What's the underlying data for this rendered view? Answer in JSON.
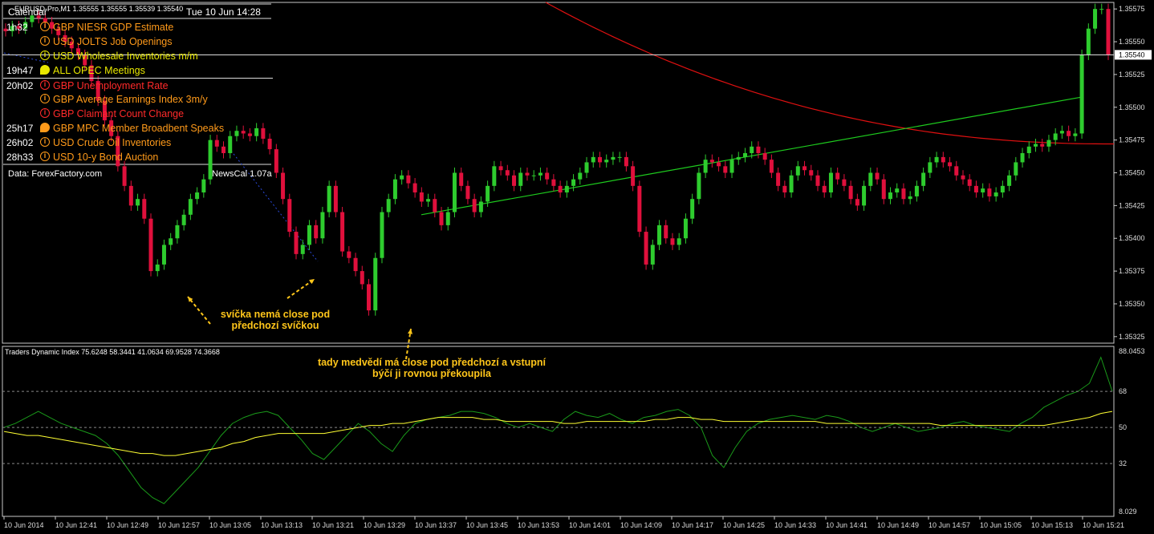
{
  "window": {
    "symbol_label": "EURUSD-Pro,M1  1.35555 1.35555 1.35539 1.35540",
    "indicator_label": "Traders Dynamic Index 75.6248 58.3441 41.0634 69.9528 74.3668"
  },
  "calendar": {
    "title": "Calendar",
    "datetime": "Tue 10 Jun 14:28",
    "events": [
      {
        "time": "1h32",
        "icon": "info-icon",
        "currency": "GBP",
        "name": "NIESR GDP Estimate",
        "color": "#ff9a1a"
      },
      {
        "time": "",
        "icon": "info-icon",
        "currency": "USD",
        "name": "JOLTS Job Openings",
        "color": "#ff9a1a"
      },
      {
        "time": "",
        "icon": "info-icon",
        "currency": "USD",
        "name": "Wholesale Inventories m/m",
        "color": "#e8e800"
      },
      {
        "time": "19h47",
        "icon": "speech-icon",
        "currency": "ALL",
        "name": "OPEC Meetings",
        "color": "#e8e800"
      },
      {
        "time": "20h02",
        "icon": "info-icon",
        "currency": "GBP",
        "name": "Unemployment Rate",
        "color": "#ff2a2a"
      },
      {
        "time": "",
        "icon": "info-icon",
        "currency": "GBP",
        "name": "Average Earnings Index 3m/y",
        "color": "#ff9a1a"
      },
      {
        "time": "",
        "icon": "info-icon",
        "currency": "GBP",
        "name": "Claimant Count Change",
        "color": "#ff2a2a"
      },
      {
        "time": "25h17",
        "icon": "speech-icon",
        "currency": "GBP",
        "name": "MPC Member Broadbent Speaks",
        "color": "#ff9a1a"
      },
      {
        "time": "26h02",
        "icon": "info-icon",
        "currency": "USD",
        "name": "Crude Oil Inventories",
        "color": "#ff9a1a"
      },
      {
        "time": "28h33",
        "icon": "info-icon",
        "currency": "USD",
        "name": "10-y Bond Auction",
        "color": "#ff9a1a"
      }
    ],
    "footer": "Data: ForexFactory.com",
    "version": "NewsCal 1.07a"
  },
  "annotations": [
    {
      "line1": "svíčka nemá close pod",
      "line2": "předchozí svíčkou"
    },
    {
      "line1": "tady medvědí má close pod předchozí a vstupní",
      "line2": "býčí ji rovnou překoupila"
    }
  ],
  "colors": {
    "bull": "#2ecc2e",
    "bear": "#e0103c",
    "ma": "#e01010",
    "trendline": "#1ecc1e",
    "tdi_green": "#1a9a1a",
    "tdi_yellow": "#ffff33",
    "annotation": "#ffc61a"
  },
  "chart_data": {
    "type": "candlestick",
    "price_axis": {
      "ticks": [
        "1.35575",
        "1.35550",
        "1.35525",
        "1.35500",
        "1.35475",
        "1.35450",
        "1.35425",
        "1.35400",
        "1.35375",
        "1.35350",
        "1.35325"
      ],
      "current_price": "1.35540",
      "ylim": [
        1.3532,
        1.3558
      ]
    },
    "indicator_axis": {
      "ticks": [
        "88.0453",
        "68",
        "50",
        "32",
        "8.029"
      ],
      "levels": [
        68,
        50,
        32
      ],
      "ylim": [
        8.029,
        88.0453
      ]
    },
    "x_labels": [
      "10 Jun 2014",
      "10 Jun 12:41",
      "10 Jun 12:49",
      "10 Jun 12:57",
      "10 Jun 13:05",
      "10 Jun 13:13",
      "10 Jun 13:21",
      "10 Jun 13:29",
      "10 Jun 13:37",
      "10 Jun 13:45",
      "10 Jun 13:53",
      "10 Jun 14:01",
      "10 Jun 14:09",
      "10 Jun 14:17",
      "10 Jun 14:25",
      "10 Jun 14:33",
      "10 Jun 14:41",
      "10 Jun 14:49",
      "10 Jun 14:57",
      "10 Jun 15:05",
      "10 Jun 15:13",
      "10 Jun 15:21"
    ],
    "closes": [
      1.35558,
      1.35562,
      1.3556,
      1.35565,
      1.3557,
      1.35568,
      1.35565,
      1.3556,
      1.35555,
      1.3555,
      1.35545,
      1.3554,
      1.35532,
      1.3552,
      1.35505,
      1.3549,
      1.35478,
      1.35455,
      1.3544,
      1.35425,
      1.3543,
      1.35415,
      1.35375,
      1.3538,
      1.35395,
      1.354,
      1.3541,
      1.35418,
      1.3543,
      1.35435,
      1.35445,
      1.35475,
      1.3547,
      1.35465,
      1.35478,
      1.35482,
      1.3548,
      1.35478,
      1.35484,
      1.35476,
      1.35468,
      1.3545,
      1.3543,
      1.35405,
      1.35388,
      1.35395,
      1.3541,
      1.354,
      1.3542,
      1.3544,
      1.3542,
      1.3539,
      1.35385,
      1.35375,
      1.35365,
      1.35345,
      1.35385,
      1.3542,
      1.3543,
      1.35445,
      1.35448,
      1.35442,
      1.35435,
      1.35428,
      1.3543,
      1.3542,
      1.3541,
      1.3542,
      1.3545,
      1.3544,
      1.3543,
      1.3542,
      1.35428,
      1.3544,
      1.35455,
      1.35452,
      1.35448,
      1.3544,
      1.3545,
      1.35448,
      1.35448,
      1.3545,
      1.35445,
      1.3544,
      1.35435,
      1.3544,
      1.35445,
      1.3545,
      1.35458,
      1.35462,
      1.35458,
      1.3546,
      1.35462,
      1.35462,
      1.35455,
      1.3544,
      1.35405,
      1.3538,
      1.35395,
      1.3541,
      1.354,
      1.35395,
      1.354,
      1.35415,
      1.3543,
      1.3545,
      1.3546,
      1.35458,
      1.35455,
      1.3545,
      1.3546,
      1.35462,
      1.35465,
      1.3547,
      1.35465,
      1.3546,
      1.3545,
      1.3544,
      1.35435,
      1.35448,
      1.35455,
      1.35452,
      1.35448,
      1.3544,
      1.35435,
      1.3545,
      1.35445,
      1.3544,
      1.3543,
      1.35425,
      1.3544,
      1.3545,
      1.35445,
      1.3543,
      1.35435,
      1.35438,
      1.3543,
      1.35432,
      1.3544,
      1.3545,
      1.35458,
      1.35462,
      1.35458,
      1.35455,
      1.35448,
      1.35445,
      1.3544,
      1.35435,
      1.35438,
      1.35432,
      1.35435,
      1.3544,
      1.35448,
      1.35458,
      1.35465,
      1.3547,
      1.35472,
      1.3547,
      1.35475,
      1.3548,
      1.35482,
      1.35478,
      1.3548,
      1.3554,
      1.3556,
      1.35575,
      1.35575,
      1.3554
    ],
    "moving_average": {
      "start": 1.3558,
      "end": 1.35472
    },
    "trendline": {
      "start": 1.35418,
      "end": 1.35508
    },
    "tdi_green": [
      50,
      52,
      55,
      58,
      55,
      52,
      50,
      48,
      46,
      42,
      36,
      28,
      20,
      15,
      12,
      18,
      24,
      30,
      38,
      46,
      52,
      55,
      57,
      58,
      56,
      50,
      44,
      37,
      34,
      40,
      46,
      52,
      48,
      42,
      38,
      46,
      52,
      54,
      55,
      56,
      58,
      58,
      57,
      55,
      52,
      50,
      52,
      50,
      48,
      54,
      58,
      56,
      55,
      57,
      54,
      52,
      55,
      56,
      58,
      59,
      56,
      50,
      36,
      30,
      40,
      48,
      52,
      54,
      55,
      56,
      55,
      54,
      56,
      55,
      53,
      50,
      48,
      50,
      52,
      50,
      48,
      49,
      50,
      52,
      53,
      51,
      50,
      49,
      48,
      52,
      55,
      60,
      63,
      66,
      68,
      72,
      85,
      68
    ],
    "tdi_yellow": [
      48,
      47,
      46,
      46,
      45,
      44,
      43,
      42,
      41,
      40,
      39,
      38,
      37,
      37,
      36,
      36,
      37,
      38,
      39,
      40,
      42,
      43,
      45,
      46,
      47,
      47,
      47,
      47,
      47,
      48,
      49,
      50,
      51,
      51,
      52,
      52,
      53,
      54,
      55,
      55,
      55,
      55,
      54,
      54,
      53,
      53,
      53,
      53,
      53,
      52,
      52,
      53,
      53,
      53,
      53,
      53,
      53,
      54,
      54,
      55,
      55,
      54,
      54,
      53,
      53,
      53,
      53,
      53,
      53,
      53,
      53,
      53,
      52,
      52,
      52,
      52,
      52,
      52,
      52,
      52,
      52,
      52,
      51,
      51,
      51,
      51,
      51,
      51,
      51,
      51,
      51,
      51,
      52,
      53,
      54,
      55,
      57,
      58
    ]
  }
}
